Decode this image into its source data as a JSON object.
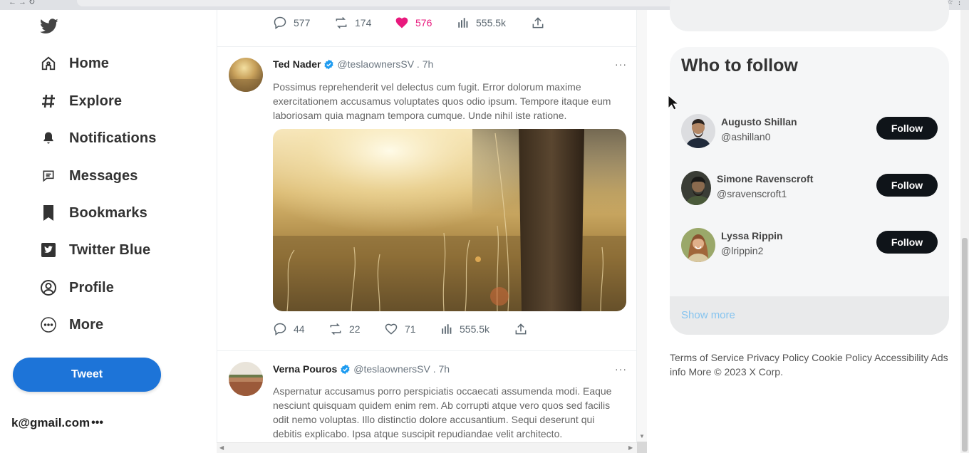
{
  "sidebar": {
    "items": [
      {
        "label": "Home",
        "icon": "home-icon"
      },
      {
        "label": "Explore",
        "icon": "hashtag-icon"
      },
      {
        "label": "Notifications",
        "icon": "bell-icon"
      },
      {
        "label": "Messages",
        "icon": "message-icon"
      },
      {
        "label": "Bookmarks",
        "icon": "bookmark-icon"
      },
      {
        "label": "Twitter Blue",
        "icon": "twitter-blue-icon"
      },
      {
        "label": "Profile",
        "icon": "profile-icon"
      },
      {
        "label": "More",
        "icon": "more-circle-icon"
      }
    ],
    "tweet_button": "Tweet",
    "account": "k@gmail.com",
    "account_dots": "•••"
  },
  "feed": {
    "top_actions": {
      "replies": "577",
      "retweets": "174",
      "likes": "576",
      "views": "555.5k"
    },
    "tweets": [
      {
        "name": "Ted Nader",
        "handle": "@teslaownersSV . 7h",
        "more": "···",
        "text": "Possimus reprehenderit vel delectus cum fugit. Error dolorum maxime exercitationem accusamus voluptates quos odio ipsum. Tempore itaque eum laboriosam quia magnam tempora cumque. Unde nihil iste ratione.",
        "replies": "44",
        "retweets": "22",
        "likes": "71",
        "views": "555.5k"
      },
      {
        "name": "Verna Pouros",
        "handle": "@teslaownersSV . 7h",
        "more": "···",
        "text": "Aspernatur accusamus porro perspiciatis occaecati assumenda modi. Eaque nesciunt quisquam quidem enim rem. Ab corrupti atque vero quos sed facilis odit nemo voluptas. Illo distinctio dolore accusantium. Sequi deserunt qui debitis explicabo. Ipsa atque suscipit repudiandae velit architecto."
      }
    ]
  },
  "who_to_follow": {
    "title": "Who to follow",
    "users": [
      {
        "name": "Augusto Shillan",
        "handle": "@ashillan0",
        "button": "Follow"
      },
      {
        "name": "Simone Ravenscroft",
        "handle": "@sravenscroft1",
        "button": "Follow"
      },
      {
        "name": "Lyssa Rippin",
        "handle": "@lrippin2",
        "button": "Follow"
      }
    ],
    "show_more": "Show more"
  },
  "footer": {
    "links": [
      "Terms of Service",
      "Privacy Policy",
      "Cookie Policy",
      "Accessibility",
      "Ads info",
      "More"
    ],
    "copyright": "© 2023 X Corp."
  },
  "colors": {
    "accent": "#1d74d8",
    "like": "#e8197d",
    "verified": "#1d9bf0",
    "follow_button": "#0f1419",
    "show_more": "#86c4ef"
  }
}
